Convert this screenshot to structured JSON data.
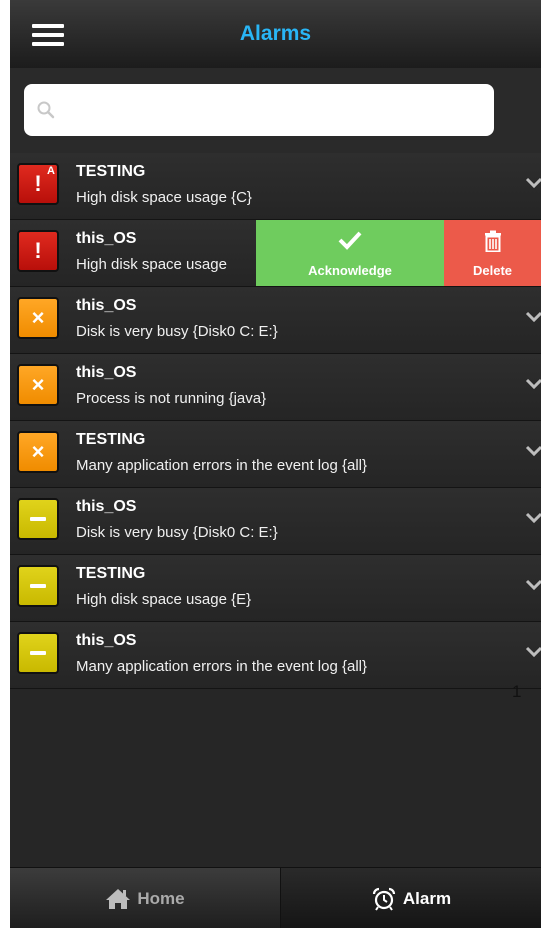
{
  "header": {
    "title": "Alarms",
    "title_color": "#29b6f6"
  },
  "search": {
    "placeholder": ""
  },
  "alarms": [
    {
      "severity": "critical",
      "badge": "A",
      "title": "TESTING",
      "description": "High disk space usage {C}"
    },
    {
      "severity": "critical",
      "badge": "",
      "title": "this_OS",
      "description": "High disk space usage"
    },
    {
      "severity": "major",
      "badge": "",
      "title": "this_OS",
      "description": "Disk is very busy {Disk0 C: E:}"
    },
    {
      "severity": "major",
      "badge": "",
      "title": "this_OS",
      "description": "Process is not running {java}"
    },
    {
      "severity": "major",
      "badge": "",
      "title": "TESTING",
      "description": "Many application errors in the event log {all}"
    },
    {
      "severity": "minor",
      "badge": "",
      "title": "this_OS",
      "description": "Disk is very busy {Disk0 C: E:}"
    },
    {
      "severity": "minor",
      "badge": "",
      "title": "TESTING",
      "description": "High disk space usage {E}"
    },
    {
      "severity": "minor",
      "badge": "",
      "title": "this_OS",
      "description": "Many application errors in the event log {all}"
    }
  ],
  "swipe_actions": {
    "acknowledge_label": "Acknowledge",
    "delete_label": "Delete",
    "acknowledge_color": "#6fcc5e",
    "delete_color": "#ec5a4a"
  },
  "pagination": {
    "page": "1"
  },
  "tabbar": {
    "home_label": "Home",
    "alarm_label": "Alarm",
    "active": "alarm"
  },
  "severity_colors": {
    "critical": "#d01c14",
    "major": "#f59c12",
    "minor": "#d6c70e"
  }
}
